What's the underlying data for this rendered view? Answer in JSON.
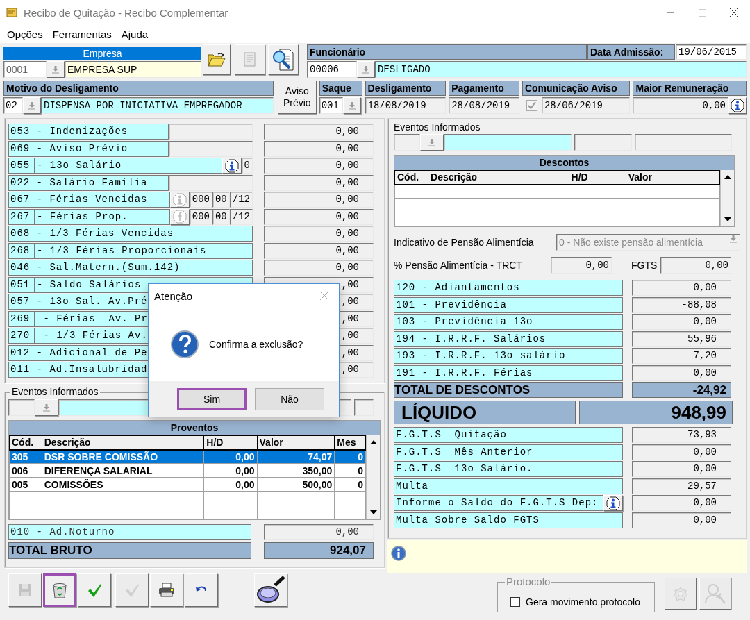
{
  "window": {
    "title": "Recibo de Quitação - Recibo Complementar"
  },
  "menu": [
    "Opções",
    "Ferramentas",
    "Ajuda"
  ],
  "empresa": {
    "label": "Empresa",
    "code": "0001",
    "name": "EMPRESA SUP"
  },
  "funcionario": {
    "label": "Funcionário",
    "code": "00006",
    "name": "DESLIGADO",
    "admission_label": "Data Admissão:",
    "admission_date": "19/06/2015"
  },
  "motivo": {
    "label": "Motivo do Desligamento",
    "code": "02",
    "name": "DISPENSA POR INICIATIVA EMPREGADOR"
  },
  "aviso_previo_button": "Aviso Prévio",
  "saque": {
    "label": "Saque",
    "code": "001"
  },
  "desligamento": {
    "label": "Desligamento",
    "date": "18/08/2019"
  },
  "pagamento": {
    "label": "Pagamento",
    "date": "28/08/2019"
  },
  "comunicacao_aviso": {
    "label": "Comunicação Aviso",
    "checked": true,
    "date": "28/06/2019"
  },
  "maior_remuneracao": {
    "label": "Maior Remuneração",
    "value": "0,00"
  },
  "verbas": [
    {
      "label": "053 - Indenizações",
      "parts": [
        {
          "kind": "field"
        }
      ],
      "value": "0,00"
    },
    {
      "label": "069 - Aviso Prévio",
      "parts": [
        {
          "kind": "field"
        }
      ],
      "value": "0,00"
    },
    {
      "code": "055",
      "label": "- 13o Salário",
      "parts": [
        {
          "kind": "info",
          "disabled": false
        },
        {
          "kind": "field",
          "text": "0"
        }
      ],
      "value": "0,00"
    },
    {
      "label": "022 - Salário Família",
      "parts": [
        {
          "kind": "field"
        }
      ],
      "value": "0,00"
    },
    {
      "label": "067 - Férias Vencidas",
      "parts": [
        {
          "kind": "info",
          "disabled": true
        },
        {
          "kind": "field",
          "text": "000"
        },
        {
          "kind": "field",
          "text": "00"
        },
        {
          "kind": "field",
          "text": "/12"
        }
      ],
      "value": "0,00"
    },
    {
      "code": "267",
      "label": "- Férias Prop.",
      "parts": [
        {
          "kind": "formula",
          "disabled": true
        },
        {
          "kind": "field",
          "text": "000"
        },
        {
          "kind": "field",
          "text": "00"
        },
        {
          "kind": "field",
          "text": "/12"
        }
      ],
      "value": "0,00"
    },
    {
      "label": "068 - 1/3 Férias Vencidas",
      "value": "0,00"
    },
    {
      "code": "268",
      "label": "- 1/3 Férias Proporcionais",
      "value": "0,00"
    },
    {
      "label": "046 - Sal.Matern.(Sum.142)",
      "value": "0,00"
    },
    {
      "code": "051",
      "label": "- Saldo Salários",
      "value": ",00"
    },
    {
      "label": "057 - 13o Sal. Av.Pré",
      "value": ",00"
    },
    {
      "code": "269",
      "label": " - Férias  Av. Pr",
      "value": ",00"
    },
    {
      "code": "270",
      "label": " - 1/3 Férias Av.",
      "value": ",00"
    },
    {
      "label": "012 - Adicional de Pe",
      "value": ",00"
    },
    {
      "label": "011 - Ad.Insalubridad",
      "value": ",00"
    }
  ],
  "eventos_left": {
    "label": "Eventos Informados"
  },
  "proventos": {
    "title": "Proventos",
    "columns": [
      "Cód.",
      "Descrição",
      "H/D",
      "Valor",
      "Mes"
    ],
    "rows": [
      {
        "cells": [
          "305",
          "DSR SOBRE COMISSÃO",
          "0,00",
          "74,07",
          "0"
        ],
        "selected": true
      },
      {
        "cells": [
          "006",
          "DIFERENÇA SALARIAL",
          "0,00",
          "350,00",
          "0"
        ],
        "selected": false
      },
      {
        "cells": [
          "005",
          "COMISSÕES",
          "0,00",
          "500,00",
          "0"
        ],
        "selected": false
      }
    ]
  },
  "ad_noturno": {
    "label": "010 - Ad.Noturno",
    "value": "0,00"
  },
  "total_bruto": {
    "label": "TOTAL BRUTO",
    "value": "924,07"
  },
  "toolbar": [
    {
      "kind": "save",
      "disabled": true,
      "highlighted": false
    },
    {
      "kind": "delete",
      "disabled": false,
      "highlighted": true
    },
    {
      "kind": "confirm",
      "disabled": false,
      "highlighted": false
    },
    {
      "kind": "confirm",
      "disabled": true,
      "highlighted": false
    },
    {
      "kind": "print",
      "disabled": false,
      "highlighted": false
    },
    {
      "kind": "undo",
      "disabled": false,
      "highlighted": false
    },
    {
      "kind": "search",
      "disabled": false,
      "highlighted": false
    }
  ],
  "eventos_right": {
    "label": "Eventos Informados"
  },
  "descontos": {
    "title": "Descontos",
    "columns": [
      "Cód.",
      "Descrição",
      "H/D",
      "Valor"
    ]
  },
  "pensao": {
    "label": "Indicativo de Pensão Alimentícia",
    "value": "0 - Não existe pensão alimentícia",
    "disabled": true
  },
  "pensao_trct": {
    "label": "% Pensão Alimentícia - TRCT",
    "value": "0,00"
  },
  "fgts": {
    "label": "FGTS",
    "value": "0,00"
  },
  "descontos_list": [
    {
      "label": "120 - Adiantamentos",
      "value": "0,00"
    },
    {
      "label": "101 - Previdência",
      "value": "-88,08"
    },
    {
      "label": "103 - Previdência 13o",
      "value": "0,00"
    },
    {
      "label": "194 - I.R.R.F. Salários",
      "value": "55,96"
    },
    {
      "label": "193 - I.R.R.F. 13o salário",
      "value": "7,20"
    },
    {
      "label": "191 - I.R.R.F. Férias",
      "value": "0,00"
    }
  ],
  "total_descontos": {
    "label": "TOTAL DE DESCONTOS",
    "value": "-24,92"
  },
  "liquido": {
    "label": "LÍQUIDO",
    "value": "948,99"
  },
  "fgts_list": [
    {
      "label": "F.G.T.S  Quitação",
      "value": "73,93",
      "info": false
    },
    {
      "label": "F.G.T.S  Mês Anterior",
      "value": "0,00",
      "info": false
    },
    {
      "label": "F.G.T.S  13o Salário.",
      "value": "0,00",
      "info": false
    },
    {
      "label": "Multa",
      "value": "29,57",
      "info": false
    },
    {
      "label": "Informe o Saldo do F.G.T.S Dep:",
      "value": "0,00",
      "info": true
    },
    {
      "label": "Multa Sobre Saldo FGTS",
      "value": "0,00",
      "info": false
    }
  ],
  "protocolo": {
    "label": "Protocolo",
    "option": "Gera movimento protocolo",
    "checked": false
  },
  "bottom_buttons": [
    {
      "kind": "settings",
      "disabled": true
    },
    {
      "kind": "person-search",
      "disabled": true
    }
  ],
  "dialog": {
    "title": "Atenção",
    "message": "Confirma a exclusão?",
    "buttons": [
      {
        "label": "Sim",
        "highlighted": true
      },
      {
        "label": "Não",
        "highlighted": false
      }
    ]
  }
}
